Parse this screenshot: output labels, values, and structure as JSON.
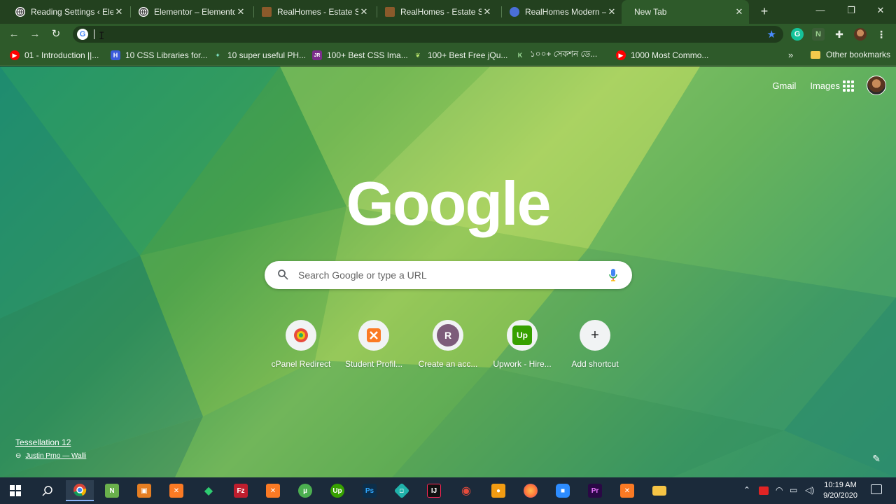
{
  "tabs": [
    {
      "title": "Reading Settings ‹ Elementor",
      "favicon": "globe-icon",
      "active": false
    },
    {
      "title": "Elementor – Elementor",
      "favicon": "globe-icon",
      "active": false
    },
    {
      "title": "RealHomes - Estate Sale",
      "favicon": "realhomes-icon",
      "active": false
    },
    {
      "title": "RealHomes - Estate Sale",
      "favicon": "realhomes-icon",
      "active": false
    },
    {
      "title": "RealHomes Modern – S",
      "favicon": "realhomes-modern-icon",
      "active": false
    },
    {
      "title": "New Tab",
      "favicon": "",
      "active": true
    }
  ],
  "omnibox": {
    "value": "",
    "placeholder": ""
  },
  "bookmarks": [
    {
      "label": "01 - Introduction ||...",
      "icon": "youtube-icon",
      "color": "#ff0000"
    },
    {
      "label": "10 CSS Libraries for...",
      "icon": "h-icon",
      "color": "#3b5bdb"
    },
    {
      "label": "10 super useful PH...",
      "icon": "spark-icon",
      "color": "#2a9d8f"
    },
    {
      "label": "100+ Best CSS Ima...",
      "icon": "jr-icon",
      "color": "#7b2d8b"
    },
    {
      "label": "100+ Best Free jQu...",
      "icon": "leaf-icon",
      "color": "#3a7d2c"
    },
    {
      "label": "১০০+ সেকশন ডে...",
      "icon": "k-icon",
      "color": "#1e5128"
    },
    {
      "label": "1000 Most Commo...",
      "icon": "youtube-icon",
      "color": "#ff0000"
    }
  ],
  "bookmarks_overflow": "»",
  "other_bookmarks": "Other bookmarks",
  "page": {
    "links": {
      "gmail": "Gmail",
      "images": "Images"
    },
    "logo": "Google",
    "search_placeholder": "Search Google or type a URL",
    "shortcuts": [
      {
        "label": "cPanel Redirect",
        "icon": "cpanel-icon"
      },
      {
        "label": "Student Profil...",
        "icon": "xampp-icon"
      },
      {
        "label": "Create an acc...",
        "icon": "letter-r-icon",
        "letter": "R"
      },
      {
        "label": "Upwork - Hire...",
        "icon": "upwork-icon",
        "letter": "Up"
      },
      {
        "label": "Add shortcut",
        "icon": "plus-icon",
        "letter": "+"
      }
    ],
    "attribution": {
      "title": "Tessellation 12",
      "author": "Justin Prno — Walli"
    }
  },
  "taskbar": {
    "time": "10:19 AM",
    "date": "9/20/2020",
    "apps": [
      {
        "name": "windows-start-icon",
        "color": "#1b2a3a"
      },
      {
        "name": "search-icon",
        "color": "#1b2a3a"
      },
      {
        "name": "chrome-icon",
        "color": "#1b2a3a",
        "active": true
      },
      {
        "name": "notepad-plus-icon",
        "color": "#6ab04c"
      },
      {
        "name": "app-orange-icon",
        "color": "#e67e22"
      },
      {
        "name": "xampp-icon",
        "color": "#fb7a24"
      },
      {
        "name": "green-diamond-icon",
        "color": "#2ecc71"
      },
      {
        "name": "filezilla-icon",
        "color": "#bf1e2e"
      },
      {
        "name": "xampp-icon",
        "color": "#fb7a24"
      },
      {
        "name": "utorrent-icon",
        "color": "#4caf50"
      },
      {
        "name": "upwork-icon",
        "color": "#37a000"
      },
      {
        "name": "photoshop-icon",
        "color": "#0c2e4a"
      },
      {
        "name": "gitkraken-icon",
        "color": "#20b2aa"
      },
      {
        "name": "intellij-icon",
        "color": "#111111"
      },
      {
        "name": "eye-app-icon",
        "color": "#c0392b"
      },
      {
        "name": "app-orange-2-icon",
        "color": "#f39c12"
      },
      {
        "name": "firefox-icon",
        "color": "#ff7139"
      },
      {
        "name": "zoom-icon",
        "color": "#2d8cff"
      },
      {
        "name": "premiere-icon",
        "color": "#2a0845"
      },
      {
        "name": "xampp-icon",
        "color": "#fb7a24"
      },
      {
        "name": "file-explorer-icon",
        "color": "#f6c445"
      }
    ]
  }
}
